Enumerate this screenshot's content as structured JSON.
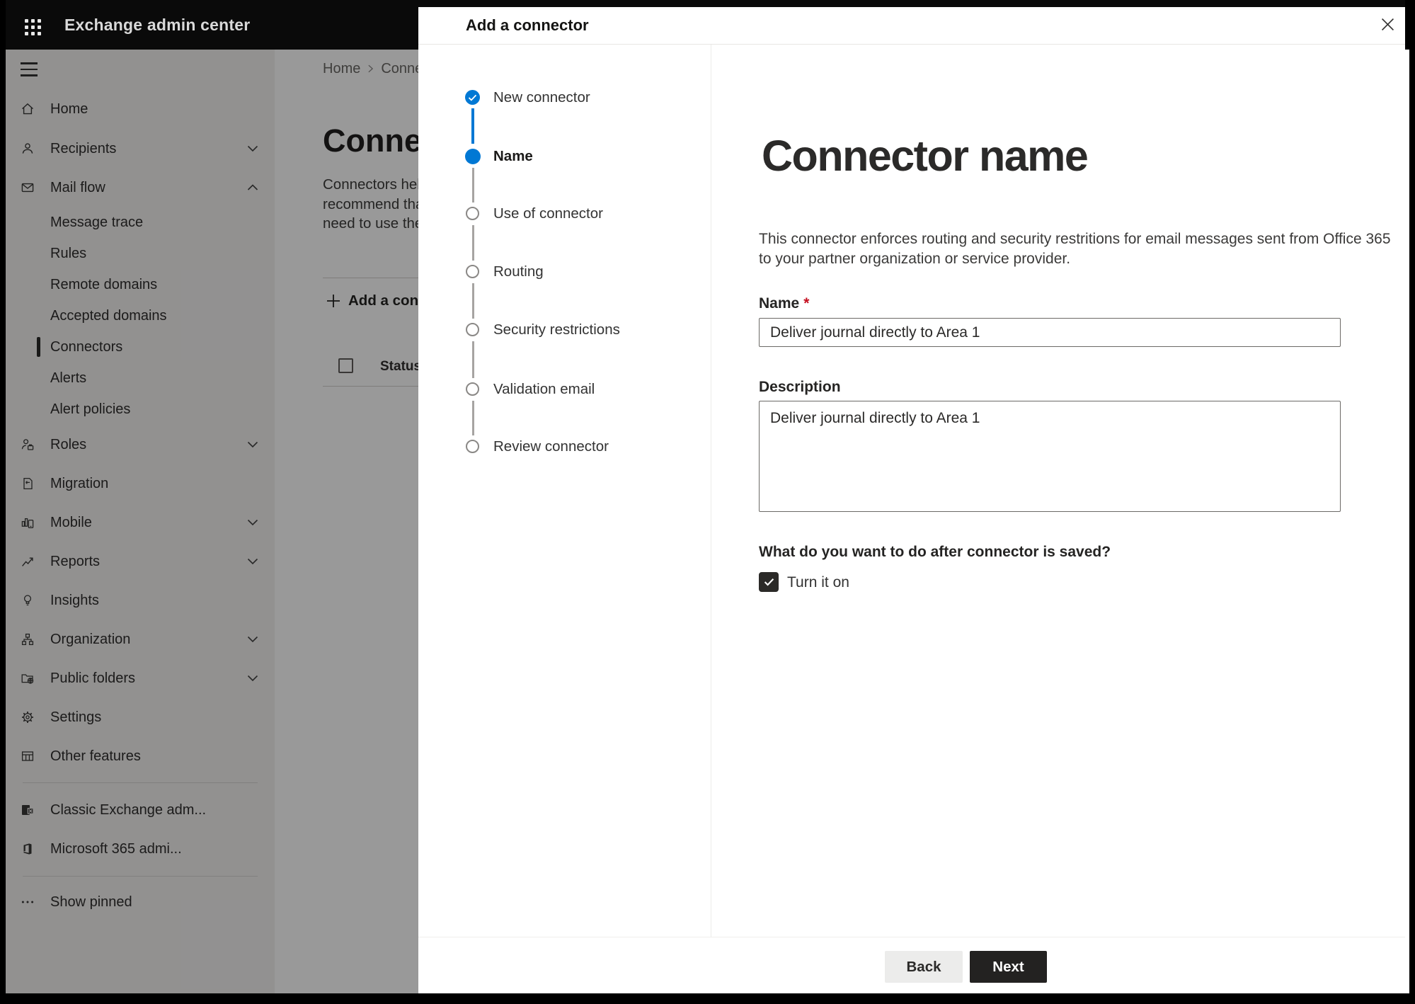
{
  "chrome": {
    "topbar_title": "Exchange admin center"
  },
  "sidebar": {
    "items": [
      {
        "label": "Home",
        "icon": "home-icon"
      },
      {
        "label": "Recipients",
        "icon": "person-icon",
        "chevron": "down"
      },
      {
        "label": "Mail flow",
        "icon": "mail-icon",
        "chevron": "up",
        "expanded": true
      },
      {
        "label": "Message trace",
        "sub": true
      },
      {
        "label": "Rules",
        "sub": true
      },
      {
        "label": "Remote domains",
        "sub": true
      },
      {
        "label": "Accepted domains",
        "sub": true
      },
      {
        "label": "Connectors",
        "sub": true,
        "selected": true
      },
      {
        "label": "Alerts",
        "sub": true
      },
      {
        "label": "Alert policies",
        "sub": true
      },
      {
        "label": "Roles",
        "icon": "roles-icon",
        "chevron": "down"
      },
      {
        "label": "Migration",
        "icon": "migration-icon"
      },
      {
        "label": "Mobile",
        "icon": "mobile-icon",
        "chevron": "down"
      },
      {
        "label": "Reports",
        "icon": "reports-icon",
        "chevron": "down"
      },
      {
        "label": "Insights",
        "icon": "lightbulb-icon"
      },
      {
        "label": "Organization",
        "icon": "org-chart-icon",
        "chevron": "down"
      },
      {
        "label": "Public folders",
        "icon": "folder-globe-icon",
        "chevron": "down"
      },
      {
        "label": "Settings",
        "icon": "gear-icon"
      },
      {
        "label": "Other features",
        "icon": "grid-icon"
      },
      {
        "label": "Classic Exchange adm...",
        "icon": "exchange-logo-icon"
      },
      {
        "label": "Microsoft 365 admi...",
        "icon": "office-logo-icon"
      },
      {
        "label": "Show pinned",
        "icon": "ellipsis-icon"
      }
    ]
  },
  "page": {
    "breadcrumb_home": "Home",
    "breadcrumb_current": "Connectors",
    "title": "Connectors",
    "intro_lines": [
      "Connectors help",
      "recommend that",
      "need to use ther"
    ],
    "add_connector_label": "Add a connector",
    "status_header": "Status"
  },
  "dialog": {
    "title": "Add a connector",
    "steps": [
      {
        "label": "New connector",
        "state": "completed"
      },
      {
        "label": "Name",
        "state": "current"
      },
      {
        "label": "Use of connector",
        "state": "upcoming"
      },
      {
        "label": "Routing",
        "state": "upcoming"
      },
      {
        "label": "Security restrictions",
        "state": "upcoming"
      },
      {
        "label": "Validation email",
        "state": "upcoming"
      },
      {
        "label": "Review connector",
        "state": "upcoming"
      }
    ],
    "content": {
      "heading": "Connector name",
      "description_line1": "This connector enforces routing and security restritions for email messages sent from Office 365",
      "description_line2": "to your partner organization or service provider.",
      "name_label": "Name",
      "required_marker": "*",
      "name_value": "Deliver journal directly to Area 1",
      "description_label": "Description",
      "description_value": "Deliver journal directly to Area 1",
      "after_save_question": "What do you want to do after connector is saved?",
      "turn_on_label": "Turn it on",
      "turn_on_checked": true
    },
    "footer": {
      "back_label": "Back",
      "next_label": "Next"
    }
  },
  "colors": {
    "accent_blue": "#0078d4",
    "topbar_bg": "#0a0a0a",
    "sidebar_bg": "#f3f2f1",
    "overlay": "rgba(0,0,0,0.40)",
    "required_red": "#c50f1f",
    "next_button_bg": "#232221",
    "back_button_bg": "#ececeb",
    "step_upcoming_ring": "#8a8886"
  }
}
